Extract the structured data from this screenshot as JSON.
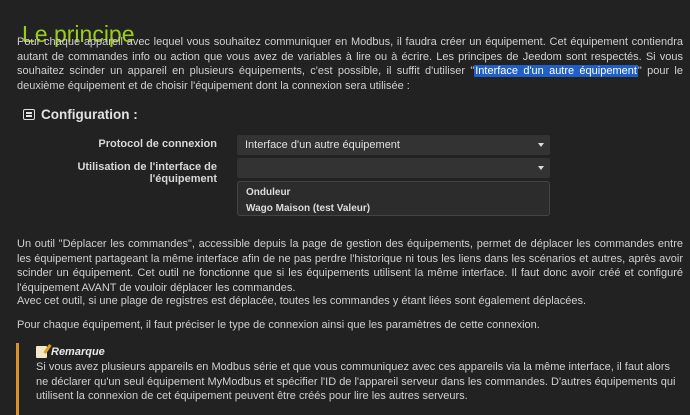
{
  "page": {
    "title": "Le principe"
  },
  "intro": {
    "part1": "Pour chaque appareil avec lequel vous souhaitez communiquer en Modbus, il faudra créer un équipement. Cet équipement contiendra autant de commandes info ou action que vous avez de variables à lire ou à écrire. Les principes de Jeedom sont respectés. Si vous souhaitez scinder un appareil en plusieurs équipements, c'est possible, il suffit d'utiliser \"",
    "highlight": "Interface d'un autre équipement",
    "part2": "\" pour le deuxième équipement et de choisir l'équipement dont la connexion sera utilisée :"
  },
  "config": {
    "heading": "Configuration :",
    "icon": "list-alt-icon",
    "protocol_label": "Protocol de connexion",
    "protocol_value": "Interface d'un autre équipement",
    "interface_label": "Utilisation de l'interface de l'équipement",
    "interface_value": "",
    "interface_options": [
      "Onduleur",
      "Wago Maison (test Valeur)"
    ]
  },
  "body": {
    "para1": "Un outil \"Déplacer les commandes\", accessible depuis la page de gestion des équipements, permet de déplacer les commandes entre les équipement partageant la même interface afin de ne pas perdre l'historique ni tous les liens dans les scénarios et autres, après avoir scinder un équipement. Cet outil ne fonctionne que si les équipements utilisent la même interface. Il faut donc avoir créé et configuré l'équipement AVANT de vouloir déplacer les commandes.",
    "para2": "Avec cet outil, si une plage de registres est déplacée, toutes les commandes y étant liées sont également déplacées.",
    "para3": "Pour chaque équipement, il faut préciser le type de connexion ainsi que les paramètres de cette connexion."
  },
  "remark": {
    "icon": "memo-icon",
    "title": "Remarque",
    "accent": "#d9912c",
    "text": "Si vous avez plusieurs appareils en Modbus série et que vous communiquez avec ces appareils via la même interface, il faut alors ne déclarer qu'un seul équipement MyModbus et spécifier l'ID de l'appareil serveur dans les commandes. D'autres équipements qui utilisent la connexion de cet équipement peuvent être créés pour lire les autres serveurs."
  },
  "colors": {
    "background": "#222222",
    "title": "#9ccc1a",
    "highlight": "#1f5fc6"
  }
}
